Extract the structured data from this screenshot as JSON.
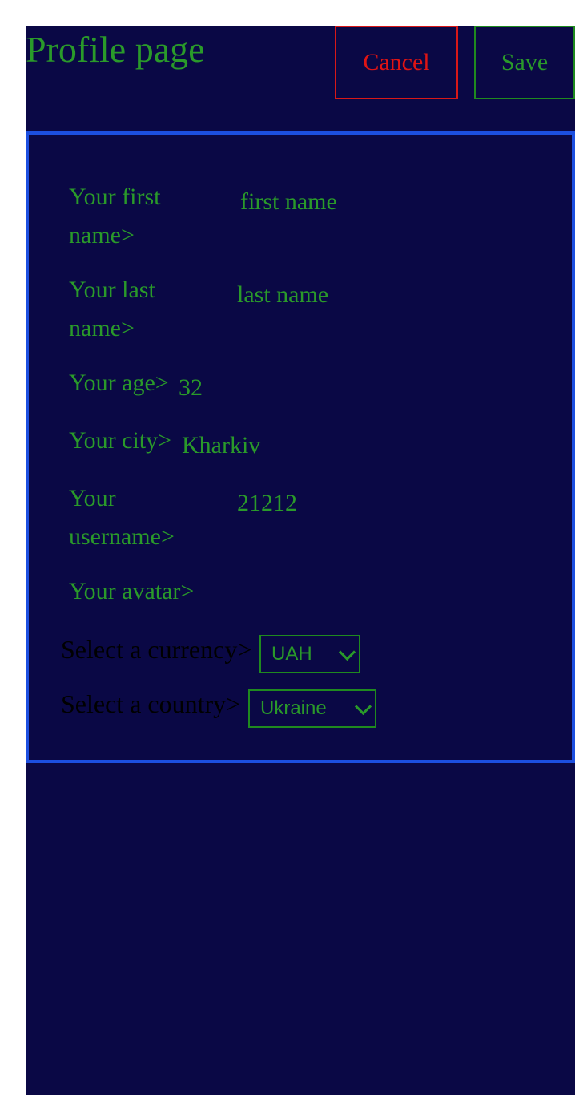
{
  "header": {
    "title": "Profile page",
    "cancel_label": "Cancel",
    "save_label": "Save"
  },
  "profile": {
    "first_name": {
      "label_line1": "Your first",
      "label_line2": "name>",
      "value": "first name"
    },
    "last_name": {
      "label_line1": "Your last",
      "label_line2": "name>",
      "value": "last name"
    },
    "age": {
      "label": "Your age>",
      "value": "32"
    },
    "city": {
      "label": "Your city>",
      "value": "Kharkiv"
    },
    "username": {
      "label_line1": "Your",
      "label_line2": "username>",
      "value": "21212"
    },
    "avatar": {
      "label": "Your avatar>"
    }
  },
  "currency": {
    "label": "Select a currency>",
    "selected": "UAH"
  },
  "country": {
    "label": "Select a country>",
    "selected": "Ukraine"
  },
  "colors": {
    "background": "#0a0845",
    "text": "#2a9a2a",
    "cancel": "#e01414",
    "panel_border": "#1c4fe0"
  }
}
